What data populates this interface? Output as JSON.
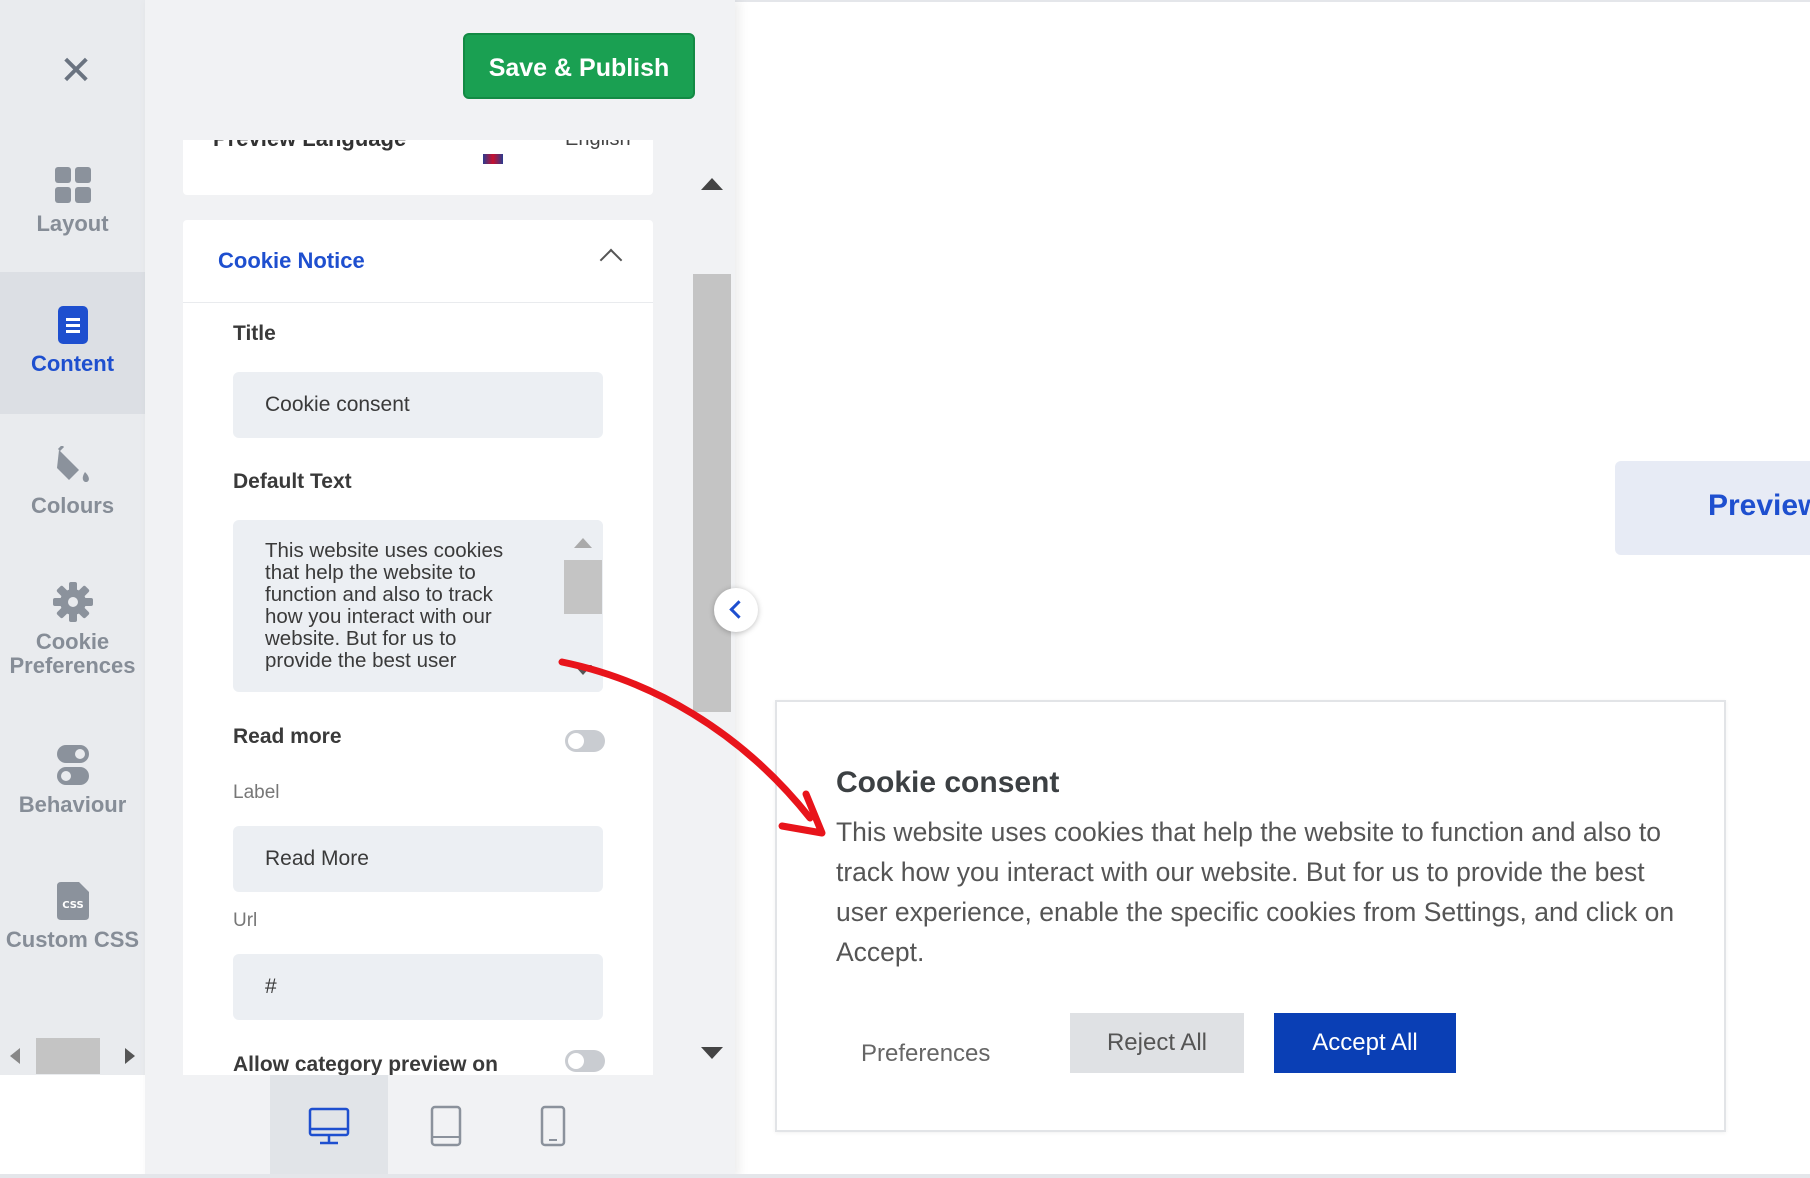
{
  "toolbar": {
    "close_icon": "close-icon",
    "save_label": "Save & Publish"
  },
  "rail": {
    "items": [
      {
        "label": "Layout",
        "icon": "layout-grid-icon"
      },
      {
        "label": "Content",
        "icon": "content-document-icon",
        "active": true
      },
      {
        "label": "Colours",
        "icon": "paint-bucket-icon"
      },
      {
        "label": "Cookie Preferences",
        "icon": "gear-icon"
      },
      {
        "label": "Behaviour",
        "icon": "toggle-icon"
      },
      {
        "label": "Custom CSS",
        "icon": "css-file-icon"
      }
    ]
  },
  "panel": {
    "language": {
      "label": "Preview Language",
      "value": "English"
    },
    "section_title": "Cookie Notice",
    "fields": {
      "title_label": "Title",
      "title_value": "Cookie consent",
      "default_text_label": "Default Text",
      "default_text_value": "This website uses cookies that help the website to function and also to track how you interact with our website. But for us to provide the best user",
      "read_more_label": "Read more",
      "label_label": "Label",
      "label_value": "Read More",
      "url_label": "Url",
      "url_value": "#",
      "category_preview_label": "Allow category preview on"
    },
    "devices": [
      "desktop-icon",
      "tablet-icon",
      "mobile-icon"
    ]
  },
  "preview": {
    "tab_label": "Preview",
    "banner": {
      "title": "Cookie consent",
      "text": "This website uses cookies that help the website to function and also to track how you interact with our website. But for us to provide the best user experience, enable the specific cookies from Settings, and click on Accept.",
      "preferences_label": "Preferences",
      "reject_label": "Reject All",
      "accept_label": "Accept All"
    }
  },
  "colors": {
    "accent": "#1e4fcf",
    "save": "#1aa052",
    "accept": "#0a3fb5",
    "annotation": "#e8141b"
  }
}
